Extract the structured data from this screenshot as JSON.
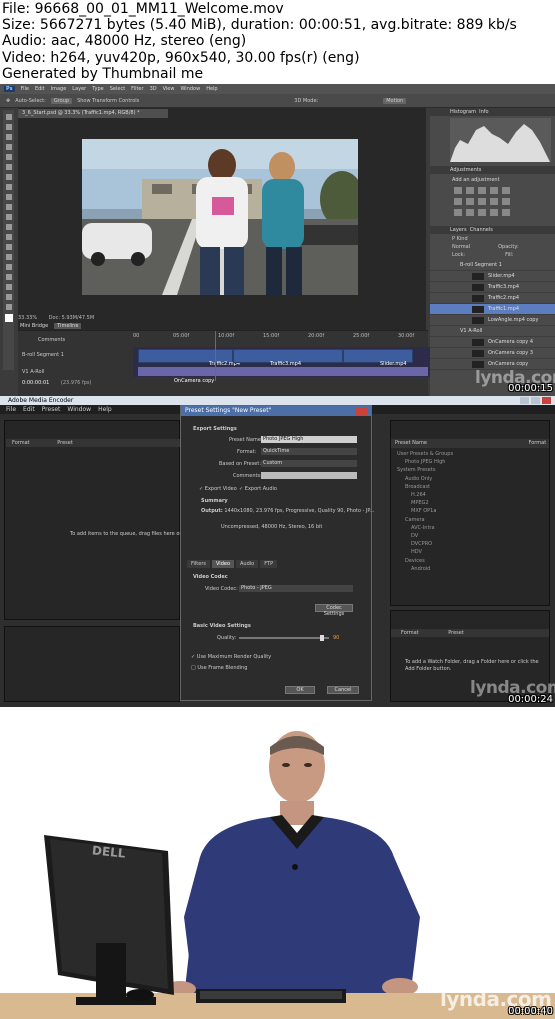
{
  "header": {
    "lines": [
      "File: 96668_00_01_MM11_Welcome.mov",
      "Size: 5667271 bytes (5.40 MiB), duration: 00:00:51, avg.bitrate: 889 kb/s",
      "Audio: aac, 48000 Hz, stereo (eng)",
      "Video: h264, yuv420p, 960x540, 30.00 fps(r) (eng)",
      "Generated by Thumbnail me"
    ]
  },
  "frame1": {
    "timestamp": "00:00:15",
    "watermark": "lynda.com",
    "menu": [
      "Ps",
      "File",
      "Edit",
      "Image",
      "Layer",
      "Type",
      "Select",
      "Filter",
      "3D",
      "View",
      "Window",
      "Help"
    ],
    "options": {
      "auto_select": "Auto-Select:",
      "group": "Group",
      "show_transform": "Show Transform Controls",
      "mode_3d": "3D Mode:",
      "motion": "Motion"
    },
    "doc_tab": "3_6_Start.psd @ 33.3% (Traffic1.mp4, RGB/8) *",
    "status": {
      "zoom": "33.33%",
      "doc_size": "Doc: 5.93M/47.5M"
    },
    "timeline_tabs": [
      "Mini Bridge",
      "Timeline"
    ],
    "ruler": [
      "00",
      "05:00f",
      "10:00f",
      "15:00f",
      "20:00f",
      "25:00f",
      "30:00f"
    ],
    "tracks": [
      "Comments",
      "B-roll Segment 1",
      "V1 A-Roll"
    ],
    "clips": [
      "Traffic2.mp4",
      "Traffic3.mp4",
      "Slider.mp4"
    ],
    "clip_bottom": "OnCamera copy",
    "timecode": "0:00:00:01",
    "fps": "(23.976 fps)",
    "panels": {
      "histogram": "Histogram",
      "info": "Info",
      "adjustments": "Adjustments",
      "add_adjustment": "Add an adjustment",
      "layers": "Layers",
      "channels": "Channels",
      "kind": "P Kind",
      "normal": "Normal",
      "opacity": "Opacity:",
      "fill": "Fill:",
      "lock": "Lock:"
    },
    "layers": [
      "B-roll Segment 1",
      "Slider.mp4",
      "Traffic3.mp4",
      "Traffic2.mp4",
      "Traffic1.mp4",
      "LowAngle.mp4 copy",
      "V1 A-Roll",
      "OnCamera copy 4",
      "OnCamera copy 3",
      "OnCamera copy"
    ],
    "selected_layer": "Traffic1.mp4"
  },
  "frame2": {
    "timestamp": "00:00:24",
    "watermark": "lynda.com",
    "app_title": "Adobe Media Encoder",
    "menu": [
      "File",
      "Edit",
      "Preset",
      "Window",
      "Help"
    ],
    "queue_cols": [
      "Format",
      "Preset"
    ],
    "queue_hint": "To add items to the queue, drag files here or click the Add Source button.",
    "dialog": {
      "title": "Preset Settings \"New Preset\"",
      "export_settings": "Export Settings",
      "preset_name_label": "Preset Name:",
      "preset_name_value": "Photo JPEG High",
      "format_label": "Format:",
      "format_value": "QuickTime",
      "based_on_label": "Based on Preset:",
      "based_on_value": "Custom",
      "comments_label": "Comments:",
      "export_video": "Export Video",
      "export_audio": "Export Audio",
      "summary": "Summary",
      "output_label": "Output:",
      "output_value": "1440x1080, 23.976 fps, Progressive, Quality 90, Photo - JP...",
      "output_audio": "Uncompressed, 48000 Hz, Stereo, 16 bit",
      "tabs": [
        "Filters",
        "Video",
        "Audio",
        "FTP"
      ],
      "video_codec_section": "Video Codec",
      "video_codec_label": "Video Codec:",
      "video_codec_value": "Photo - JPEG",
      "codec_settings": "Codec Settings",
      "basic_video": "Basic Video Settings",
      "quality_label": "Quality:",
      "quality_value": "90",
      "max_render": "Use Maximum Render Quality",
      "frame_blending": "Use Frame Blending",
      "ok": "OK",
      "cancel": "Cancel"
    },
    "preset_browser": {
      "cols": [
        "Preset Name",
        "Format"
      ],
      "tree": [
        "User Presets & Groups",
        "Photo JPEG High",
        "System Presets",
        "Audio Only",
        "Broadcast",
        "H.264",
        "MPEG2",
        "MXF OP1a",
        "Camera",
        "AVC-Intra",
        "DV",
        "DVCPRO",
        "HDV",
        "Devices",
        "Android"
      ]
    },
    "watch_cols": [
      "Format",
      "Preset"
    ],
    "watch_hint": "To add a Watch Folder, drag a Folder here or click the Add Folder button."
  },
  "frame3": {
    "timestamp": "00:00:40",
    "watermark": "lynda.com",
    "monitor_brand": "DELL"
  }
}
